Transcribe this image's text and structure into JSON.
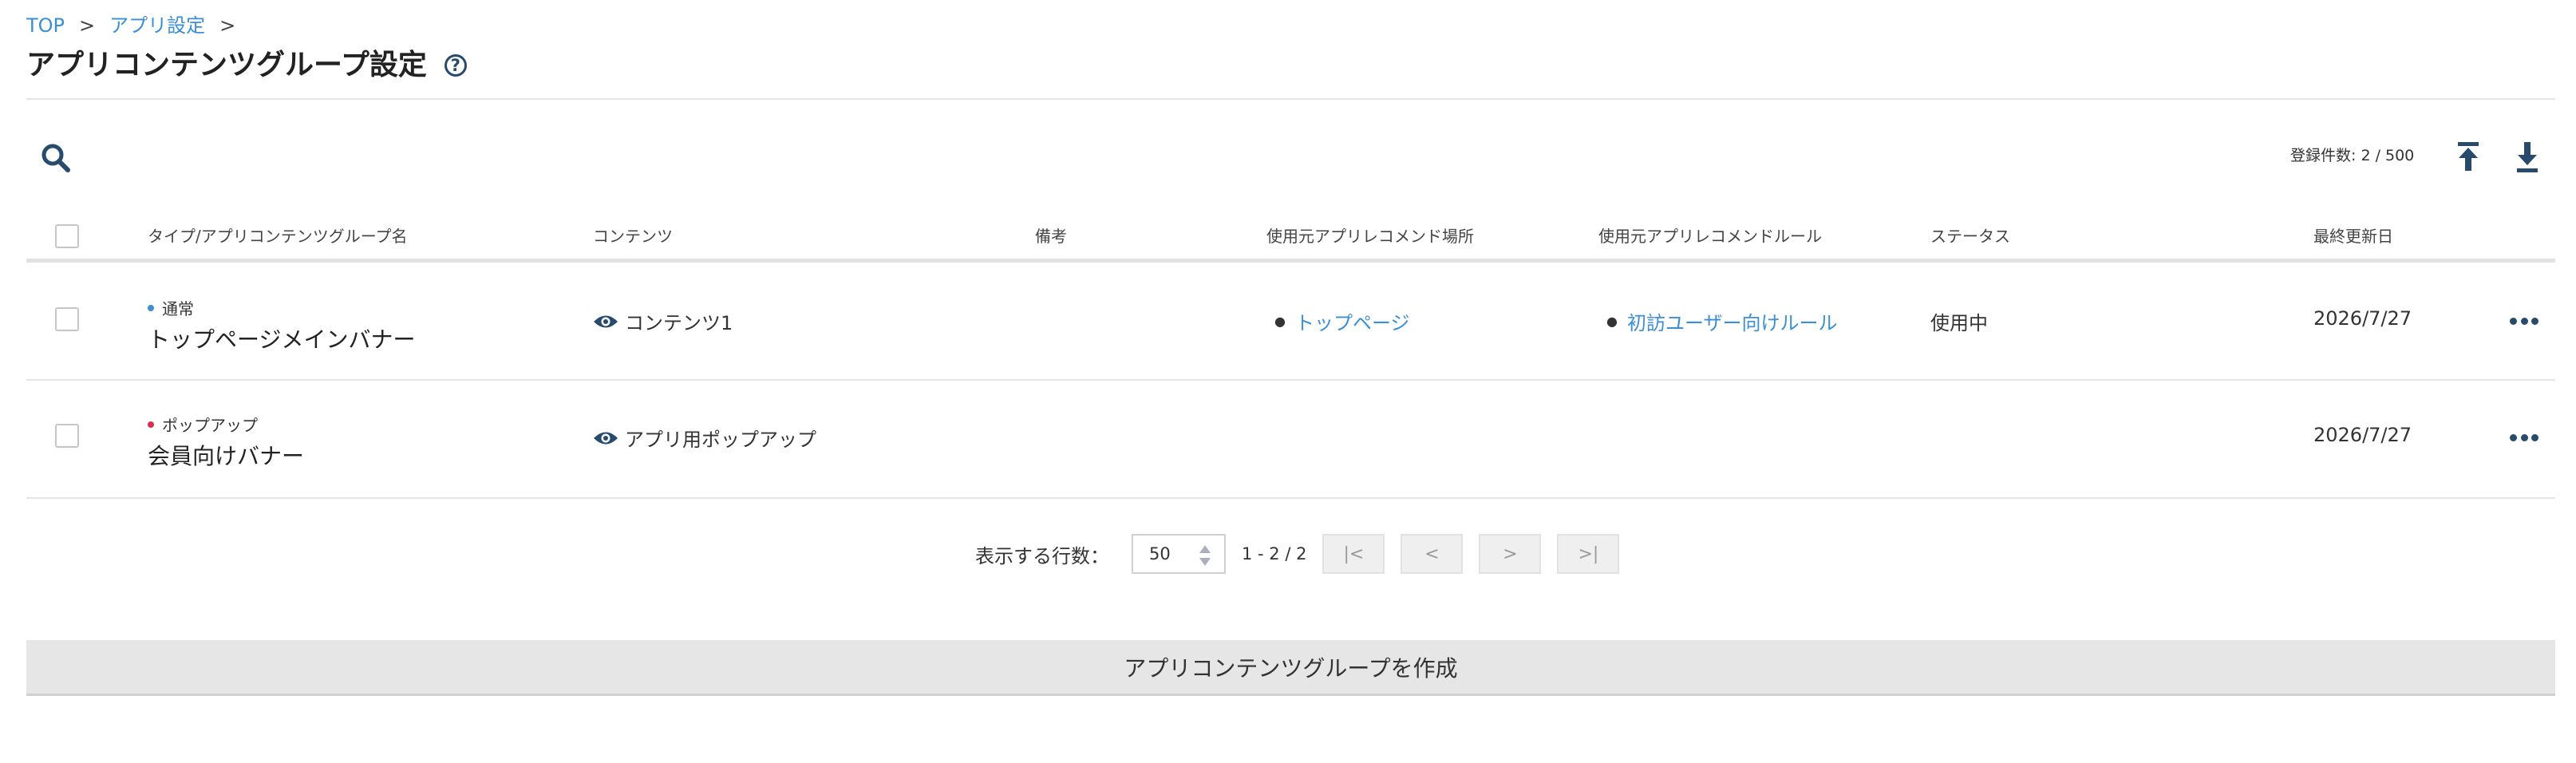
{
  "breadcrumb": {
    "items": [
      "TOP",
      "アプリ設定"
    ],
    "separator": ">"
  },
  "page": {
    "title": "アプリコンテンツグループ設定",
    "help_symbol": "?"
  },
  "toolbar": {
    "count_text": "登録件数: 2 / 500",
    "upload_icon": "upload-icon",
    "download_icon": "download-icon"
  },
  "table": {
    "headers": {
      "type_name": "タイプ/アプリコンテンツグループ名",
      "contents": "コンテンツ",
      "notes": "備考",
      "placements": "使用元アプリレコメンド場所",
      "rules": "使用元アプリレコメンドルール",
      "status": "ステータス",
      "updated": "最終更新日"
    },
    "rows": [
      {
        "type": "通常",
        "type_color": "#3a8fd6",
        "name": "トップページメインバナー",
        "content": "コンテンツ1",
        "notes": "",
        "placement": "トップページ",
        "rule": "初訪ユーザー向けルール",
        "status": "使用中",
        "updated": "2026/7/27"
      },
      {
        "type": "ポップアップ",
        "type_color": "#d9304f",
        "name": "会員向けバナー",
        "content": "アプリ用ポップアップ",
        "notes": "",
        "placement": "",
        "rule": "",
        "status": "",
        "updated": "2026/7/27"
      }
    ]
  },
  "pagination": {
    "rows_label": "表示する行数：",
    "rows_value": "50",
    "range": "1 - 2 / 2",
    "first": "|<",
    "prev": "<",
    "next": ">",
    "last": ">|"
  },
  "create_button": "アプリコンテンツグループを作成",
  "colors": {
    "link": "#3a8fd6",
    "icon_navy": "#274a6d"
  }
}
